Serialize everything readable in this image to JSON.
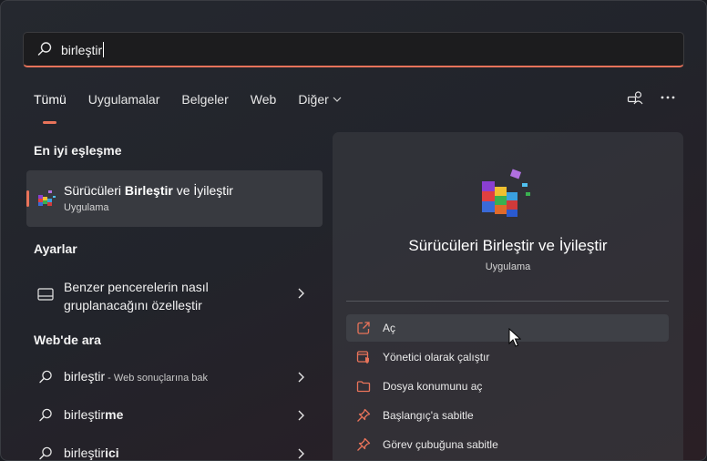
{
  "search": {
    "value": "birleştir"
  },
  "tabs": [
    {
      "label": "Tümü",
      "active": true
    },
    {
      "label": "Uygulamalar"
    },
    {
      "label": "Belgeler"
    },
    {
      "label": "Web"
    },
    {
      "label": "Diğer"
    }
  ],
  "best_match": {
    "heading": "En iyi eşleşme",
    "title_pre": "Sürücüleri ",
    "title_bold": "Birleştir",
    "title_post": " ve İyileştir",
    "subtitle": "Uygulama"
  },
  "settings": {
    "heading": "Ayarlar",
    "item_line1": "Benzer pencerelerin nasıl",
    "item_line2": "gruplanacağını özelleştir"
  },
  "web": {
    "heading": "Web'de ara",
    "items": [
      {
        "pre": "birleştir",
        "bold": "",
        "suffix": " - Web sonuçlarına bak"
      },
      {
        "pre": "birleştir",
        "bold": "me",
        "suffix": ""
      },
      {
        "pre": "birleştir",
        "bold": "ici",
        "suffix": ""
      }
    ]
  },
  "detail": {
    "app_name": "Sürücüleri Birleştir ve İyileştir",
    "app_type": "Uygulama",
    "actions": [
      {
        "label": "Aç",
        "icon": "open-external-icon"
      },
      {
        "label": "Yönetici olarak çalıştır",
        "icon": "run-as-admin-icon"
      },
      {
        "label": "Dosya konumunu aç",
        "icon": "folder-icon"
      },
      {
        "label": "Başlangıç'a sabitle",
        "icon": "pin-icon"
      },
      {
        "label": "Görev çubuğuna sabitle",
        "icon": "pin-icon"
      }
    ]
  },
  "colors": {
    "accent": "#e8735a",
    "background": "#23252c",
    "selected": "#383a40"
  }
}
